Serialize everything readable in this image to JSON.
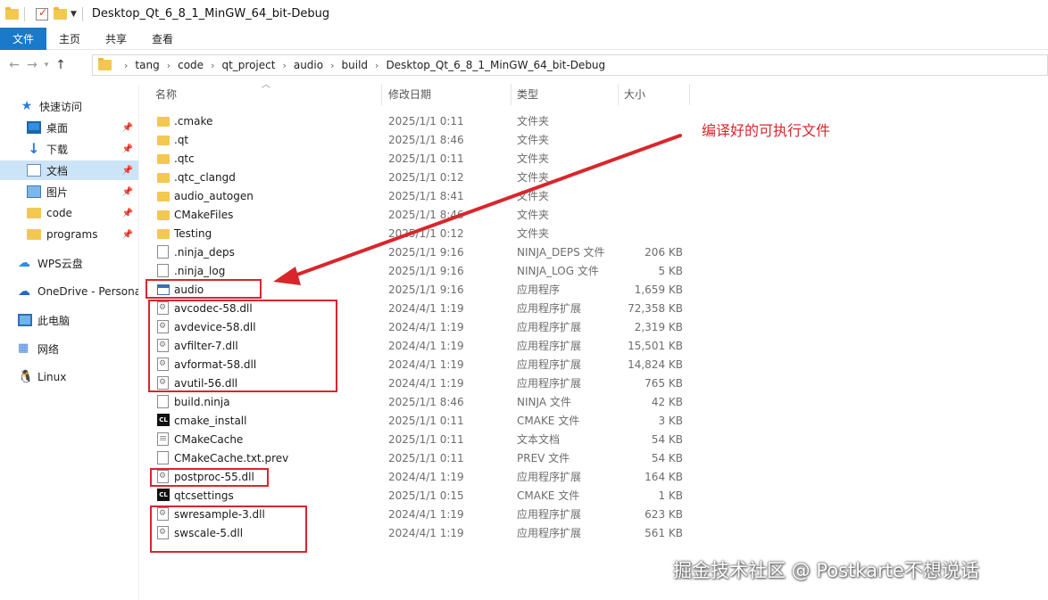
{
  "window": {
    "title": "Desktop_Qt_6_8_1_MinGW_64_bit-Debug"
  },
  "ribbon": {
    "tabs": [
      {
        "label": "文件",
        "active": true
      },
      {
        "label": "主页",
        "active": false
      },
      {
        "label": "共享",
        "active": false
      },
      {
        "label": "查看",
        "active": false
      }
    ]
  },
  "address": {
    "breadcrumbs": [
      "tang",
      "code",
      "qt_project",
      "audio",
      "build",
      "Desktop_Qt_6_8_1_MinGW_64_bit-Debug"
    ]
  },
  "sidebar": {
    "items": [
      {
        "label": "快速访问",
        "icon": "star-icon",
        "pinned": false
      },
      {
        "label": "桌面",
        "icon": "desktop-icon",
        "pinned": true
      },
      {
        "label": "下载",
        "icon": "download-icon",
        "pinned": true
      },
      {
        "label": "文档",
        "icon": "document-icon",
        "pinned": true,
        "selected": true
      },
      {
        "label": "图片",
        "icon": "picture-icon",
        "pinned": true
      },
      {
        "label": "code",
        "icon": "folder-icon",
        "pinned": true
      },
      {
        "label": "programs",
        "icon": "folder-icon",
        "pinned": true
      },
      {
        "label": "WPS云盘",
        "icon": "cloud-icon",
        "pinned": false
      },
      {
        "label": "OneDrive - Persona",
        "icon": "onedrive-icon",
        "pinned": false
      },
      {
        "label": "此电脑",
        "icon": "computer-icon",
        "pinned": false
      },
      {
        "label": "网络",
        "icon": "network-icon",
        "pinned": false
      },
      {
        "label": "Linux",
        "icon": "linux-icon",
        "pinned": false
      }
    ]
  },
  "columns": {
    "name": "名称",
    "date": "修改日期",
    "type": "类型",
    "size": "大小"
  },
  "files": [
    {
      "name": ".cmake",
      "date": "2025/1/1 0:11",
      "type": "文件夹",
      "size": "",
      "icon": "folder"
    },
    {
      "name": ".qt",
      "date": "2025/1/1 8:46",
      "type": "文件夹",
      "size": "",
      "icon": "folder"
    },
    {
      "name": ".qtc",
      "date": "2025/1/1 0:11",
      "type": "文件夹",
      "size": "",
      "icon": "folder"
    },
    {
      "name": ".qtc_clangd",
      "date": "2025/1/1 0:12",
      "type": "文件夹",
      "size": "",
      "icon": "folder"
    },
    {
      "name": "audio_autogen",
      "date": "2025/1/1 8:41",
      "type": "文件夹",
      "size": "",
      "icon": "folder"
    },
    {
      "name": "CMakeFiles",
      "date": "2025/1/1 8:46",
      "type": "文件夹",
      "size": "",
      "icon": "folder"
    },
    {
      "name": "Testing",
      "date": "2025/1/1 0:12",
      "type": "文件夹",
      "size": "",
      "icon": "folder"
    },
    {
      "name": ".ninja_deps",
      "date": "2025/1/1 9:16",
      "type": "NINJA_DEPS 文件",
      "size": "206 KB",
      "icon": "file"
    },
    {
      "name": ".ninja_log",
      "date": "2025/1/1 9:16",
      "type": "NINJA_LOG 文件",
      "size": "5 KB",
      "icon": "file"
    },
    {
      "name": "audio",
      "date": "2025/1/1 9:16",
      "type": "应用程序",
      "size": "1,659 KB",
      "icon": "exe"
    },
    {
      "name": "avcodec-58.dll",
      "date": "2024/4/1 1:19",
      "type": "应用程序扩展",
      "size": "72,358 KB",
      "icon": "dll"
    },
    {
      "name": "avdevice-58.dll",
      "date": "2024/4/1 1:19",
      "type": "应用程序扩展",
      "size": "2,319 KB",
      "icon": "dll"
    },
    {
      "name": "avfilter-7.dll",
      "date": "2024/4/1 1:19",
      "type": "应用程序扩展",
      "size": "15,501 KB",
      "icon": "dll"
    },
    {
      "name": "avformat-58.dll",
      "date": "2024/4/1 1:19",
      "type": "应用程序扩展",
      "size": "14,824 KB",
      "icon": "dll"
    },
    {
      "name": "avutil-56.dll",
      "date": "2024/4/1 1:19",
      "type": "应用程序扩展",
      "size": "765 KB",
      "icon": "dll"
    },
    {
      "name": "build.ninja",
      "date": "2025/1/1 8:46",
      "type": "NINJA 文件",
      "size": "42 KB",
      "icon": "file"
    },
    {
      "name": "cmake_install",
      "date": "2025/1/1 0:11",
      "type": "CMAKE 文件",
      "size": "3 KB",
      "icon": "cmake"
    },
    {
      "name": "CMakeCache",
      "date": "2025/1/1 0:11",
      "type": "文本文档",
      "size": "54 KB",
      "icon": "txt"
    },
    {
      "name": "CMakeCache.txt.prev",
      "date": "2025/1/1 0:11",
      "type": "PREV 文件",
      "size": "54 KB",
      "icon": "file"
    },
    {
      "name": "postproc-55.dll",
      "date": "2024/4/1 1:19",
      "type": "应用程序扩展",
      "size": "164 KB",
      "icon": "dll"
    },
    {
      "name": "qtcsettings",
      "date": "2025/1/1 0:15",
      "type": "CMAKE 文件",
      "size": "1 KB",
      "icon": "cmake"
    },
    {
      "name": "swresample-3.dll",
      "date": "2024/4/1 1:19",
      "type": "应用程序扩展",
      "size": "623 KB",
      "icon": "dll"
    },
    {
      "name": "swscale-5.dll",
      "date": "2024/4/1 1:19",
      "type": "应用程序扩展",
      "size": "561 KB",
      "icon": "dll"
    }
  ],
  "annotation": {
    "text": "编译好的可执行文件",
    "color": "#d9262b"
  },
  "watermark": {
    "text": "掘金技术社区 @ Postkarte不想说话"
  },
  "colors": {
    "accent": "#1979ca",
    "selected": "#cce4f7",
    "annotation": "#d9262b"
  }
}
